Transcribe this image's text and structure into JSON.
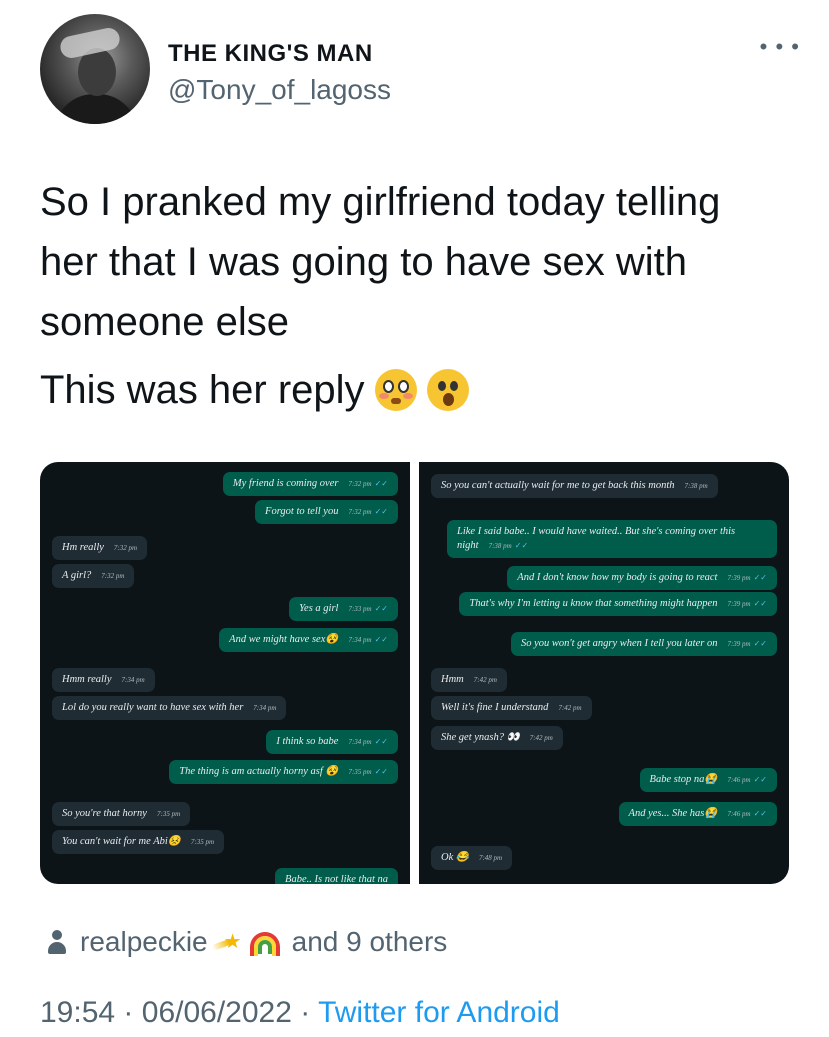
{
  "author": {
    "display_name": "THE KING'S MAN",
    "handle": "@Tony_of_lagoss",
    "avatar_icon": "profile-photo",
    "more_icon": "ellipsis-icon"
  },
  "tweet": {
    "text_line1": "So I pranked my girlfriend today telling",
    "text_line2": "her that I was going to have sex with",
    "text_line3": "someone else",
    "reply_text": "This was her reply",
    "reply_emojis": [
      "flushed-face-emoji",
      "astonished-face-emoji"
    ]
  },
  "screenshots": {
    "left": [
      {
        "text": "My friend is coming over",
        "time": "7:32 pm",
        "side": "out"
      },
      {
        "text": "Forgot to tell you",
        "time": "7:32 pm",
        "side": "out"
      },
      {
        "text": "Hm really",
        "time": "7:32 pm",
        "side": "in"
      },
      {
        "text": "A girl?",
        "time": "7:32 pm",
        "side": "in"
      },
      {
        "text": "Yes a girl",
        "time": "7:33 pm",
        "side": "out"
      },
      {
        "text": "And we might have sex😵",
        "time": "7:34 pm",
        "side": "out"
      },
      {
        "text": "Hmm really",
        "time": "7:34 pm",
        "side": "in"
      },
      {
        "text": "Lol do you really want to have sex with her",
        "time": "7:34 pm",
        "side": "in"
      },
      {
        "text": "I think so babe",
        "time": "7:34 pm",
        "side": "out"
      },
      {
        "text": "The thing is am actually horny asf 😵",
        "time": "7:35 pm",
        "side": "out"
      },
      {
        "text": "So you're that horny",
        "time": "7:35 pm",
        "side": "in"
      },
      {
        "text": "You can't wait for me Abi😣",
        "time": "7:35 pm",
        "side": "in"
      },
      {
        "text": "Babe.. Is not like that na",
        "time": "",
        "side": "out"
      }
    ],
    "right": [
      {
        "text": "So you can't actually wait for me to get back this month",
        "time": "7:38 pm",
        "side": "in"
      },
      {
        "text": "Like I said babe.. I would have waited.. But she's coming over this night",
        "time": "7:38 pm",
        "side": "out"
      },
      {
        "text": "And I don't know how my body is going to react",
        "time": "7:39 pm",
        "side": "out"
      },
      {
        "text": "That's why I'm letting u know that something might happen",
        "time": "7:39 pm",
        "side": "out"
      },
      {
        "text": "So you won't get angry when I tell you later on",
        "time": "7:39 pm",
        "side": "out"
      },
      {
        "text": "Hmm",
        "time": "7:42 pm",
        "side": "in"
      },
      {
        "text": "Well it's fine I understand",
        "time": "7:42 pm",
        "side": "in"
      },
      {
        "text": "She get ynash? 👀",
        "time": "7:42 pm",
        "side": "in"
      },
      {
        "text": "Babe stop na😭",
        "time": "7:46 pm",
        "side": "out"
      },
      {
        "text": "And yes... She has😭",
        "time": "7:46 pm",
        "side": "out"
      },
      {
        "text": "Ok 😂",
        "time": "7:48 pm",
        "side": "in"
      }
    ]
  },
  "likes": {
    "user": "realpeckie",
    "others": "and 9 others",
    "icons": [
      "person-icon",
      "dizzy-star-emoji",
      "rainbow-emoji"
    ]
  },
  "meta": {
    "time": "19:54",
    "date": "06/06/2022",
    "separator": "·",
    "source": "Twitter for Android"
  },
  "colors": {
    "text": "#0f1419",
    "secondary": "#536471",
    "link": "#1d9bf0",
    "chat_bg": "#0c1418",
    "bubble_out": "#005c4b",
    "bubble_in": "#1f2c33"
  }
}
